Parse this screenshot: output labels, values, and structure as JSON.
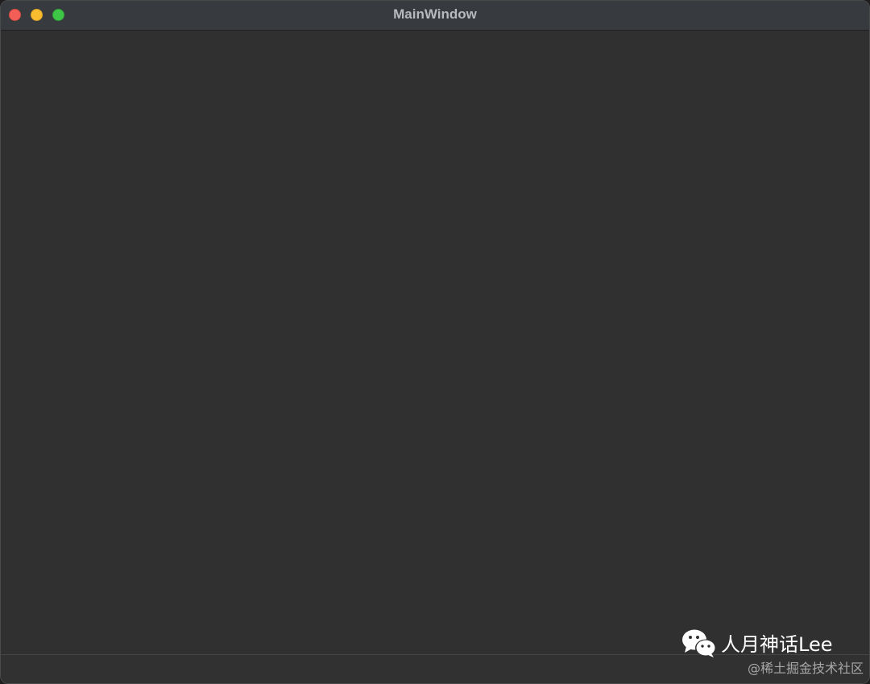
{
  "window": {
    "title": "MainWindow",
    "controls": {
      "close_color": "#f35f57",
      "minimize_color": "#f8bc2e",
      "zoom_color": "#3ec647"
    },
    "background_color": "#303030"
  },
  "watermark": {
    "logo_icon": "wechat-icon",
    "name": "人月神话Lee",
    "site": "@稀土掘金技术社区"
  }
}
